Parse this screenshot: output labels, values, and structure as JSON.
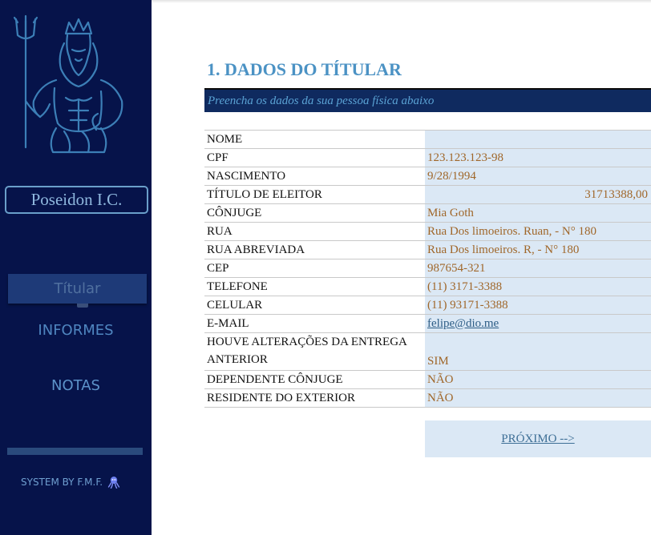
{
  "sidebar": {
    "brand": "Poseidon I.C.",
    "nav": {
      "titular": "Títular",
      "informes": "INFORMES",
      "notas": "NOTAS"
    },
    "footer": "SYSTEM BY F.M.F."
  },
  "main": {
    "title": "1. DADOS DO TÍTULAR",
    "subtitle": "Preencha os dados da sua pessoa física abaixo",
    "fields": [
      {
        "label": "NOME",
        "value": ""
      },
      {
        "label": "CPF",
        "value": "123.123.123-98"
      },
      {
        "label": "NASCIMENTO",
        "value": "9/28/1994"
      },
      {
        "label": "TÍTULO DE ELEITOR",
        "value": "31713388,00"
      },
      {
        "label": "CÔNJUGE",
        "value": "Mia Goth"
      },
      {
        "label": "RUA",
        "value": "Rua Dos limoeiros. Ruan, - N° 180"
      },
      {
        "label": "RUA ABREVIADA",
        "value": "Rua Dos limoeiros. R, - N° 180"
      },
      {
        "label": "CEP",
        "value": "987654-321"
      },
      {
        "label": "TELEFONE",
        "value": "(11) 3171-3388"
      },
      {
        "label": "CELULAR",
        "value": "(11) 93171-3388"
      },
      {
        "label": "E-MAIL",
        "value": "felipe@dio.me"
      },
      {
        "label_line1": "HOUVE ALTERAÇÕES DA ENTREGA",
        "label_line2": "ANTERIOR",
        "value": "SIM"
      },
      {
        "label": "DEPENDENTE CÔNJUGE",
        "value": "NÃO"
      },
      {
        "label": "RESIDENTE DO EXTERIOR",
        "value": "NÃO"
      }
    ],
    "next_label": "PRÓXIMO -->"
  },
  "colors": {
    "sidebar_bg": "#06134a",
    "title": "#4b92c4",
    "subtitle_bg": "#0f2a5f",
    "value_bg": "#dbe8f5",
    "value_text": "#a0672a"
  },
  "icons": {
    "logo": "poseidon-trident-icon",
    "footer": "octopus-icon"
  }
}
